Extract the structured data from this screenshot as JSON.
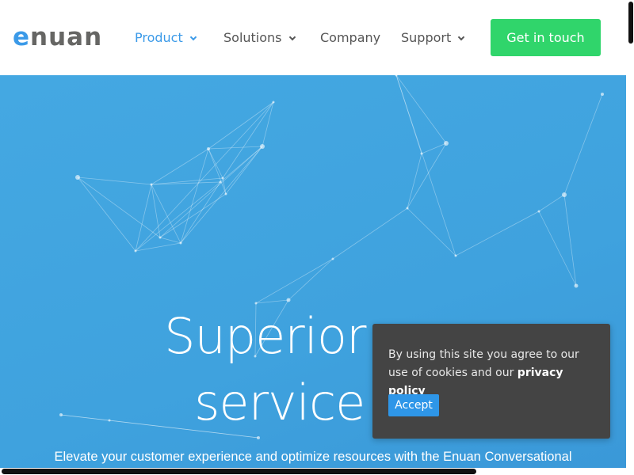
{
  "header": {
    "logo": {
      "first_letter": "e",
      "rest": "nuan"
    },
    "nav": [
      {
        "label": "Product",
        "has_dropdown": true,
        "active": true
      },
      {
        "label": "Solutions",
        "has_dropdown": true,
        "active": false
      },
      {
        "label": "Company",
        "has_dropdown": false,
        "active": false
      },
      {
        "label": "Support",
        "has_dropdown": true,
        "active": false
      }
    ],
    "cta_label": "Get in touch"
  },
  "hero": {
    "title_line1": "Superior cus",
    "title_line2": "service wi",
    "subtitle": "Elevate your customer experience and optimize resources with the Enuan Conversational"
  },
  "cookie_banner": {
    "text": "By using this site you agree to our use of cookies and our ",
    "link_label": "privacy policy",
    "accept_label": "Accept"
  },
  "colors": {
    "brand_blue": "#3b9ae8",
    "logo_gray": "#666664",
    "cta_green": "#30d56b",
    "hero_blue": "#42a5e0",
    "cookie_bg": "#444444",
    "accept_blue": "#2e96e8"
  },
  "icons": {
    "dropdown": "chevron-down-icon"
  }
}
